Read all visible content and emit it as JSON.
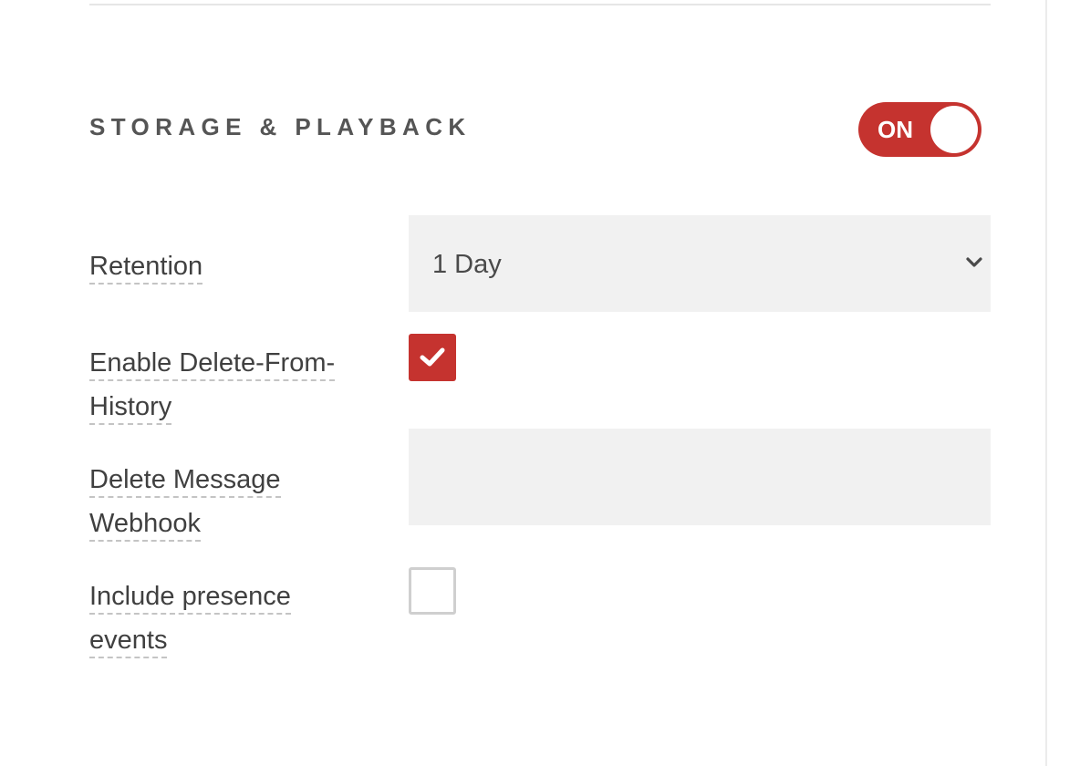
{
  "section": {
    "title": "STORAGE & PLAYBACK",
    "toggle": {
      "label": "ON",
      "state": "on",
      "color": "#c5332f"
    }
  },
  "fields": {
    "retention": {
      "label": "Retention",
      "selected": "1 Day",
      "icon": "chevron-down-icon"
    },
    "delete_from_history": {
      "label_line1": "Enable Delete-From-",
      "label_line2": "History",
      "checked": true,
      "icon": "checkmark-icon"
    },
    "delete_message_webhook": {
      "label_line1": "Delete Message",
      "label_line2": "Webhook",
      "value": "",
      "placeholder": ""
    },
    "include_presence_events": {
      "label_line1": "Include presence",
      "label_line2": "events",
      "checked": false
    }
  },
  "colors": {
    "accent": "#c5332f",
    "field_background": "#f1f1f1",
    "label_text": "#404040"
  }
}
